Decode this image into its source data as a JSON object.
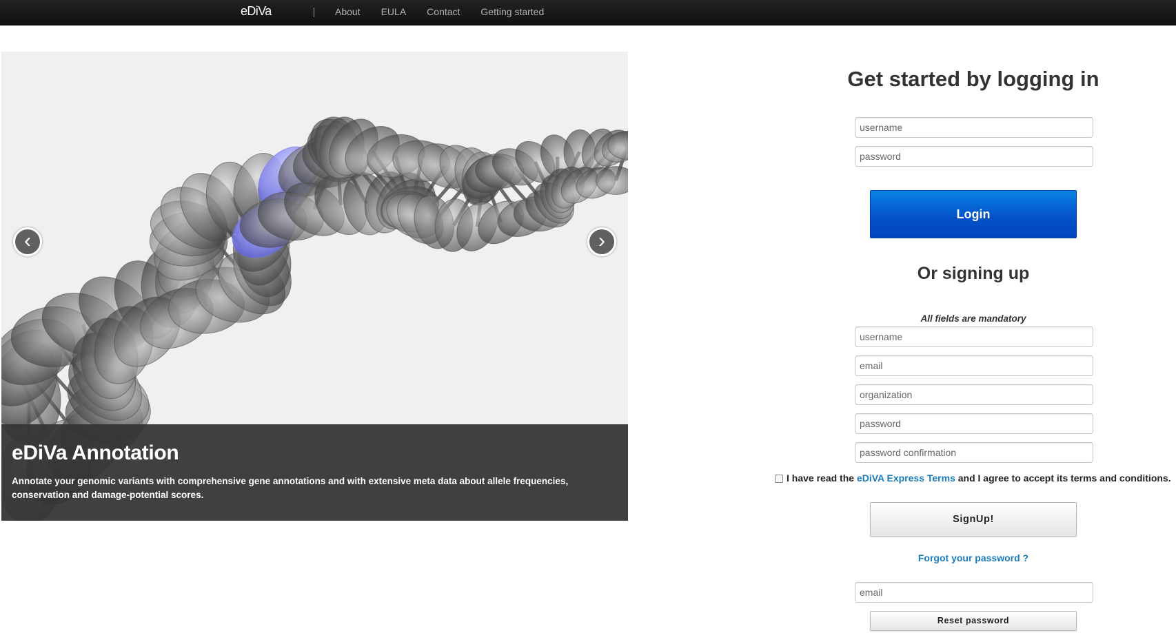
{
  "navbar": {
    "brand": "eDiVa",
    "links": [
      "About",
      "EULA",
      "Contact",
      "Getting started"
    ]
  },
  "carousel": {
    "prev_glyph": "‹",
    "next_glyph": "›",
    "caption_title": "eDiVa Annotation",
    "caption_text": "Annotate your genomic variants with comprehensive gene annotations and with extensive meta data about allele frequencies, conservation and damage-potential scores.",
    "image_icon": "dna-helix-illustration"
  },
  "login": {
    "heading": "Get started by logging in",
    "username_placeholder": "username",
    "password_placeholder": "password",
    "button_label": "Login"
  },
  "signup": {
    "heading": "Or signing up",
    "mandatory_note": "All fields are mandatory",
    "username_placeholder": "username",
    "email_placeholder": "email",
    "organization_placeholder": "organization",
    "password_placeholder": "password",
    "password_confirmation_placeholder": "password confirmation",
    "terms_prefix": "I have read the",
    "terms_link": "eDiVA Express Terms",
    "terms_suffix": "and I agree to accept its terms and conditions.",
    "button_label": "SignUp!"
  },
  "reset": {
    "forgot_link": "Forgot your password ?",
    "email_placeholder": "email",
    "button_label": "Reset password"
  },
  "colors": {
    "navbar": "#1a1a1a",
    "login_button": "#0353c8",
    "link": "#1a7bbd",
    "helix_highlight": "#8a8cf5"
  }
}
